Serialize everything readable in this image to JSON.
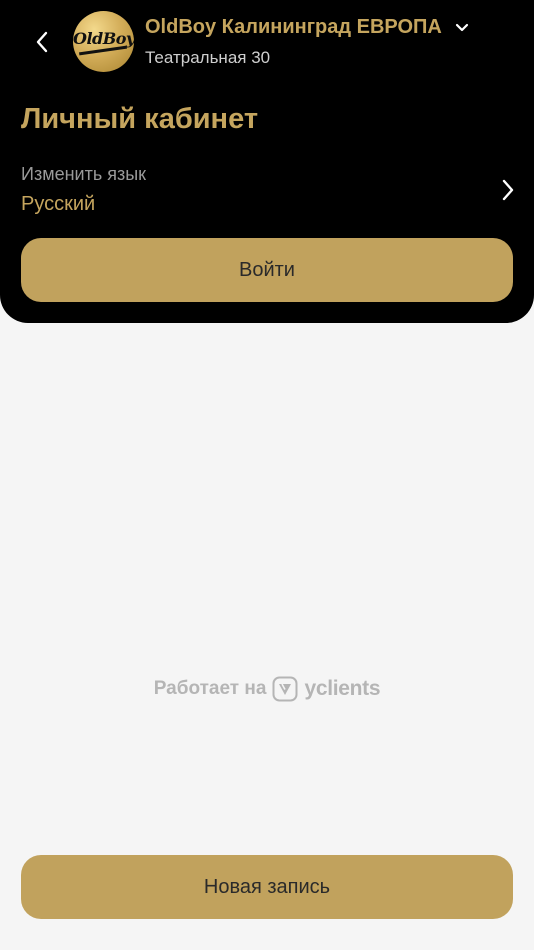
{
  "header": {
    "back_icon": "chevron-left-icon",
    "logo_text": "OldBoy",
    "salon_name": "OldBoy Калининград ЕВРОПА",
    "salon_dropdown_icon": "chevron-down-icon",
    "salon_address": "Театральная 30"
  },
  "account": {
    "title": "Личный кабинет",
    "language_label": "Изменить язык",
    "language_value": "Русский",
    "language_icon": "chevron-right-icon",
    "login_label": "Войти"
  },
  "footer": {
    "powered_by_text": "Работает на",
    "brand_icon": "yclients-logo-icon",
    "brand_name": "yclients",
    "new_booking_label": "Новая запись"
  },
  "colors": {
    "header_background": "#000000",
    "accent_gold": "#c5a55e",
    "button_gold": "#c1a25d",
    "page_background": "#f5f5f5",
    "muted_text": "#9a9a9a"
  }
}
